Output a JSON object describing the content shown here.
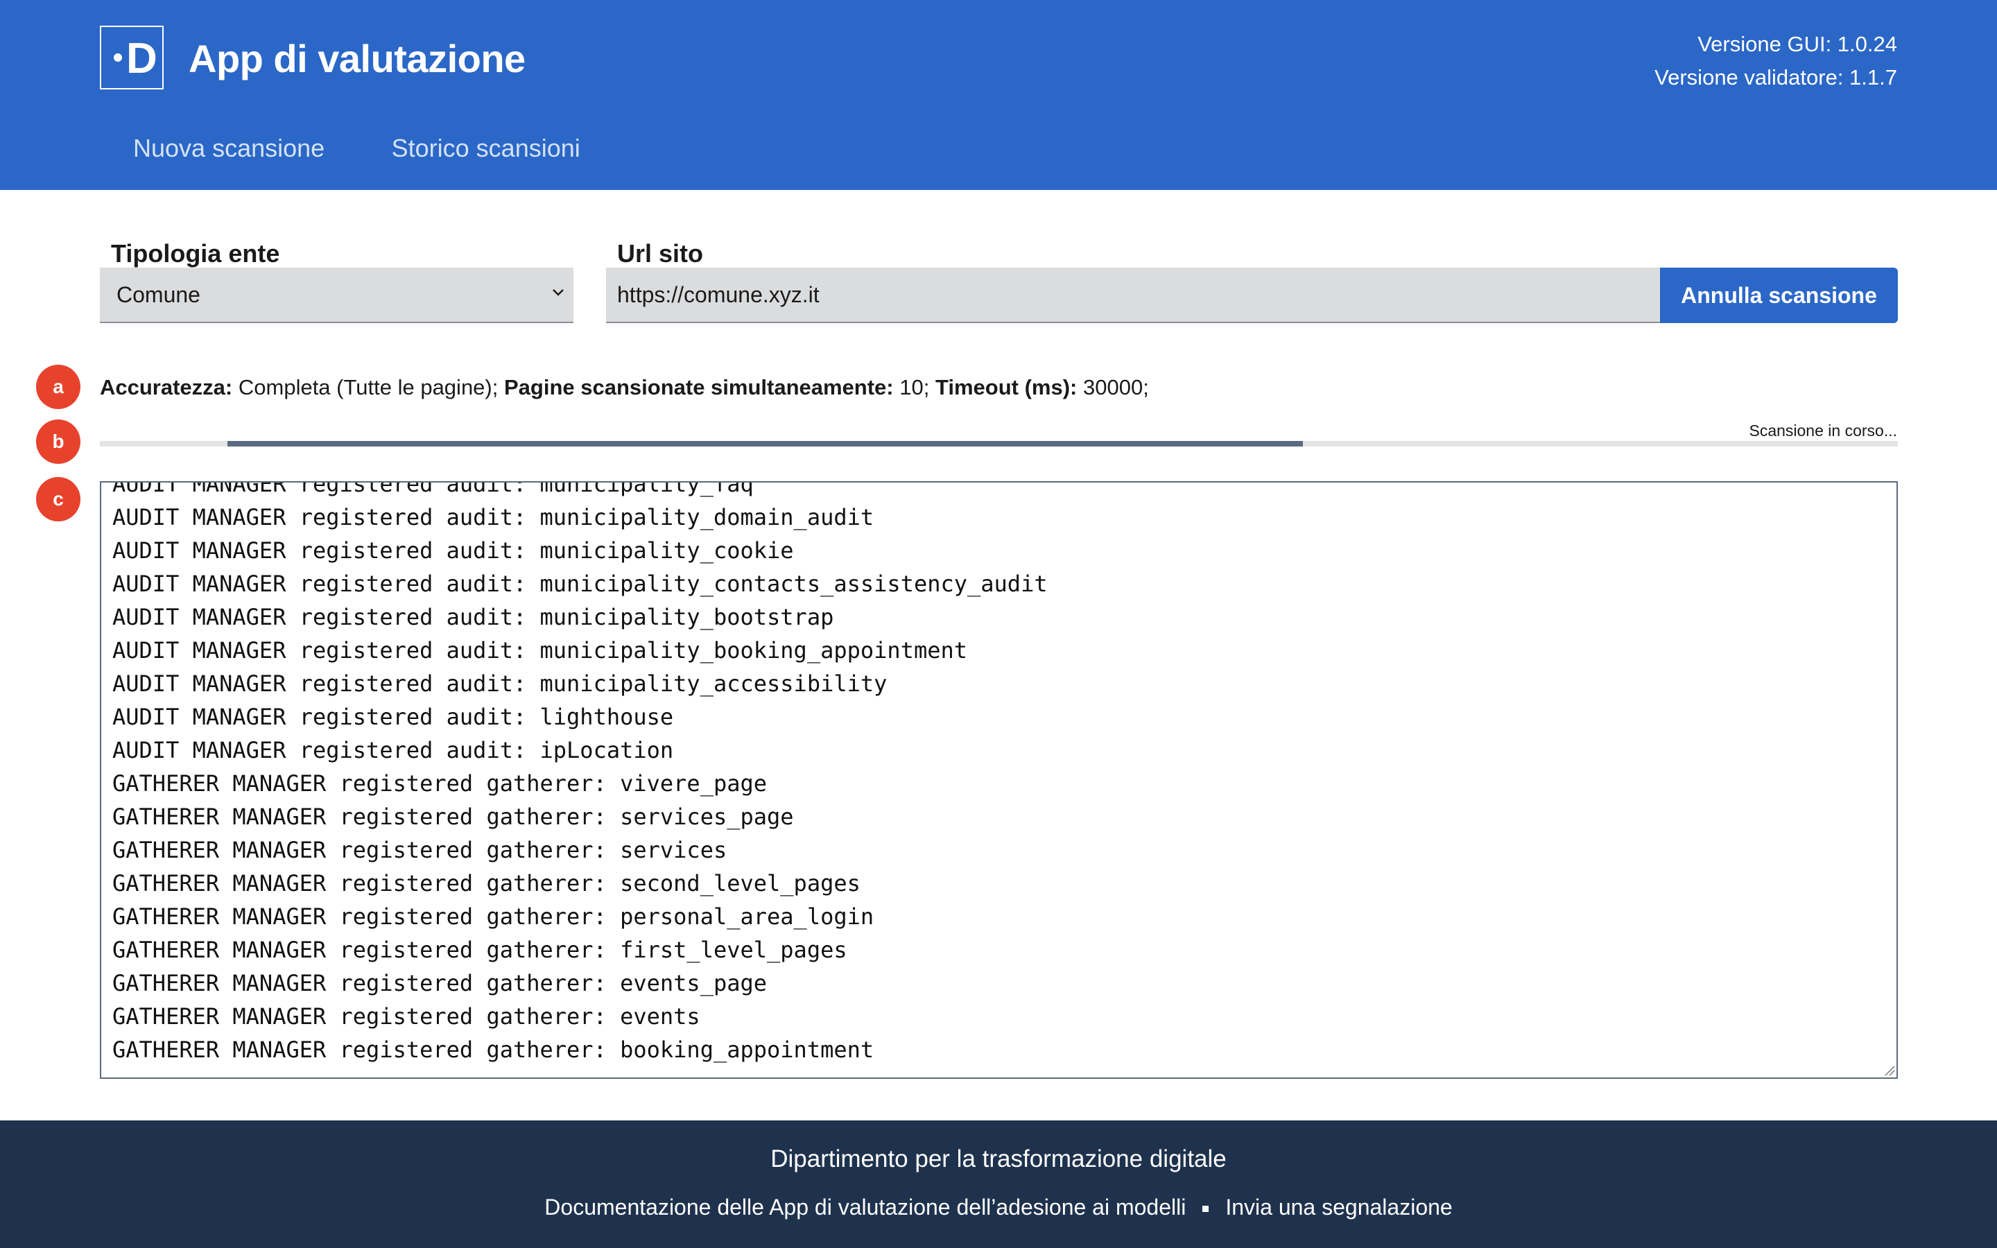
{
  "header": {
    "logo_letter": "D",
    "title": "App di valutazione",
    "gui_version": "Versione GUI: 1.0.24",
    "validator_version": "Versione validatore: 1.1.7",
    "nav": [
      "Nuova scansione",
      "Storico scansioni"
    ]
  },
  "form": {
    "entity_label": "Tipologia ente",
    "entity_value": "Comune",
    "url_label": "Url sito",
    "url_value": "https://comune.xyz.it",
    "cancel_button": "Annulla scansione"
  },
  "markers": [
    "a",
    "b",
    "c"
  ],
  "info": {
    "accuracy_label": "Accuratezza:",
    "accuracy_value": "Completa (Tutte le pagine);",
    "pages_label": "Pagine scansionate simultaneamente:",
    "pages_value": "10;",
    "timeout_label": "Timeout (ms):",
    "timeout_value": "30000;"
  },
  "progress": {
    "status": "Scansione in corso...",
    "start": 0.071,
    "end": 0.669
  },
  "log_lines": [
    "AUDIT MANAGER registered audit: municipality_faq",
    "AUDIT MANAGER registered audit: municipality_domain_audit",
    "AUDIT MANAGER registered audit: municipality_cookie",
    "AUDIT MANAGER registered audit: municipality_contacts_assistency_audit",
    "AUDIT MANAGER registered audit: municipality_bootstrap",
    "AUDIT MANAGER registered audit: municipality_booking_appointment",
    "AUDIT MANAGER registered audit: municipality_accessibility",
    "AUDIT MANAGER registered audit: lighthouse",
    "AUDIT MANAGER registered audit: ipLocation",
    "GATHERER MANAGER registered gatherer: vivere_page",
    "GATHERER MANAGER registered gatherer: services_page",
    "GATHERER MANAGER registered gatherer: services",
    "GATHERER MANAGER registered gatherer: second_level_pages",
    "GATHERER MANAGER registered gatherer: personal_area_login",
    "GATHERER MANAGER registered gatherer: first_level_pages",
    "GATHERER MANAGER registered gatherer: events_page",
    "GATHERER MANAGER registered gatherer: events",
    "GATHERER MANAGER registered gatherer: booking_appointment"
  ],
  "footer": {
    "title": "Dipartimento per la trasformazione digitale",
    "link_docs": "Documentazione delle App di valutazione dell’adesione ai modelli",
    "link_report": "Invia una segnalazione"
  },
  "colors": {
    "header_bg": "#2b67c7",
    "footer_bg": "#1f324d",
    "marker": "#e7432c",
    "progress_fill": "#5b6b7f"
  }
}
